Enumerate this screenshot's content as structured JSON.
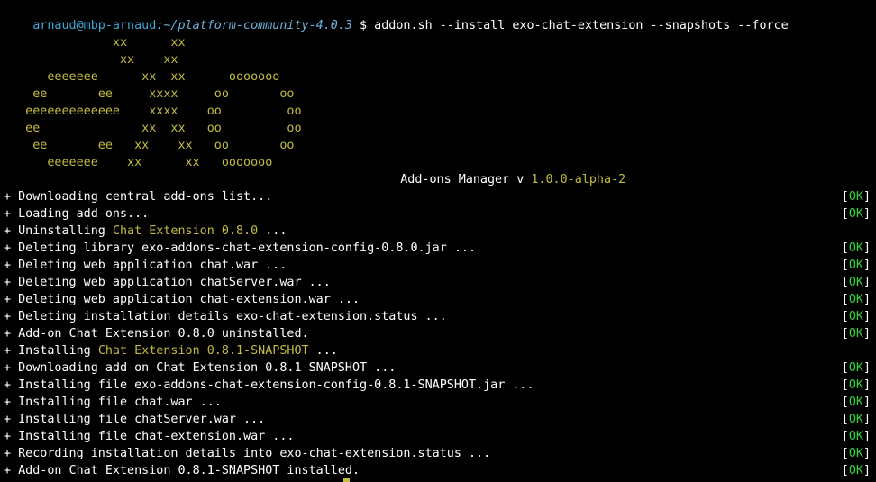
{
  "prompt": {
    "user_host": "arnaud@mbp-arnaud",
    "path": ":~/platform-community-4.0.3",
    "symbol": " $ ",
    "command": "addon.sh --install exo-chat-extension --snapshots --force"
  },
  "banner": {
    "art_lines": [
      "               xx      xx",
      "                xx    xx",
      "      eeeeeee      xx  xx      ooooooo",
      "    ee       ee     xxxx     oo       oo",
      "   eeeeeeeeeeeee    xxxx    oo         oo",
      "   ee              xx  xx   oo         oo",
      "    ee       ee   xx    xx   oo       oo",
      "      eeeeeee    xx      xx   ooooooo"
    ],
    "title": "Add-ons Manager v ",
    "version": "1.0.0-alpha-2"
  },
  "ok_label": {
    "open": "[",
    "text": "OK",
    "close": "]"
  },
  "log_lines": [
    {
      "pre": "+ Downloading central add-ons list...",
      "hl": "",
      "post": "",
      "ok": true
    },
    {
      "pre": "+ Loading add-ons...",
      "hl": "",
      "post": "",
      "ok": true
    },
    {
      "pre": "+ Uninstalling ",
      "hl": "Chat Extension 0.8.0",
      "post": " ...",
      "ok": false
    },
    {
      "pre": "+ Deleting library exo-addons-chat-extension-config-0.8.0.jar ...",
      "hl": "",
      "post": "",
      "ok": true
    },
    {
      "pre": "+ Deleting web application chat.war ...",
      "hl": "",
      "post": "",
      "ok": true
    },
    {
      "pre": "+ Deleting web application chatServer.war ...",
      "hl": "",
      "post": "",
      "ok": true
    },
    {
      "pre": "+ Deleting web application chat-extension.war ...",
      "hl": "",
      "post": "",
      "ok": true
    },
    {
      "pre": "+ Deleting installation details exo-chat-extension.status ...",
      "hl": "",
      "post": "",
      "ok": true
    },
    {
      "pre": "+ Add-on Chat Extension 0.8.0 uninstalled.",
      "hl": "",
      "post": "",
      "ok": true
    },
    {
      "pre": "+ Installing ",
      "hl": "Chat Extension 0.8.1-SNAPSHOT",
      "post": " ...",
      "ok": false
    },
    {
      "pre": "+ Downloading add-on Chat Extension 0.8.1-SNAPSHOT ...",
      "hl": "",
      "post": "",
      "ok": true
    },
    {
      "pre": "+ Installing file exo-addons-chat-extension-config-0.8.1-SNAPSHOT.jar ...",
      "hl": "",
      "post": "",
      "ok": true
    },
    {
      "pre": "+ Installing file chat.war ...",
      "hl": "",
      "post": "",
      "ok": true
    },
    {
      "pre": "+ Installing file chatServer.war ...",
      "hl": "",
      "post": "",
      "ok": true
    },
    {
      "pre": "+ Installing file chat-extension.war ...",
      "hl": "",
      "post": "",
      "ok": true
    },
    {
      "pre": "+ Recording installation details into exo-chat-extension.status ...",
      "hl": "",
      "post": "",
      "ok": true
    },
    {
      "pre": "+ Add-on Chat Extension 0.8.1-SNAPSHOT installed.",
      "hl": "",
      "post": "",
      "ok": true
    }
  ],
  "colors": {
    "background": "#000000",
    "text": "#ffffff",
    "accent": "#c2bc3f",
    "ok_green": "#33d13a",
    "prompt_blue": "#3ea7d6"
  }
}
